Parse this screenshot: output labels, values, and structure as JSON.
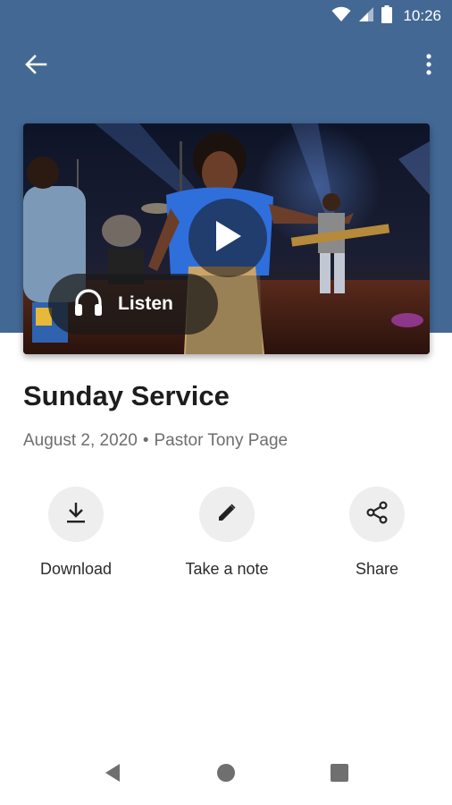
{
  "status_bar": {
    "time": "10:26",
    "icons": [
      "wifi-icon",
      "signal-icon",
      "battery-icon"
    ]
  },
  "toolbar": {
    "back_icon": "arrow-back-icon",
    "more_icon": "more-vert-icon"
  },
  "media": {
    "play_icon": "play-icon",
    "listen": {
      "icon": "headphones-icon",
      "label": "Listen"
    }
  },
  "sermon": {
    "title": "Sunday Service",
    "date": "August 2, 2020",
    "separator": "•",
    "speaker": "Pastor Tony Page"
  },
  "actions": [
    {
      "icon": "download-icon",
      "label": "Download"
    },
    {
      "icon": "pencil-icon",
      "label": "Take a note"
    },
    {
      "icon": "share-icon",
      "label": "Share"
    }
  ],
  "nav_bar": {
    "items": [
      "back-triangle-icon",
      "home-circle-icon",
      "recents-square-icon"
    ]
  },
  "colors": {
    "header": "#436894",
    "action_circle": "#eeeeee",
    "title": "#1d1d1d",
    "meta": "#6e6e6e"
  }
}
